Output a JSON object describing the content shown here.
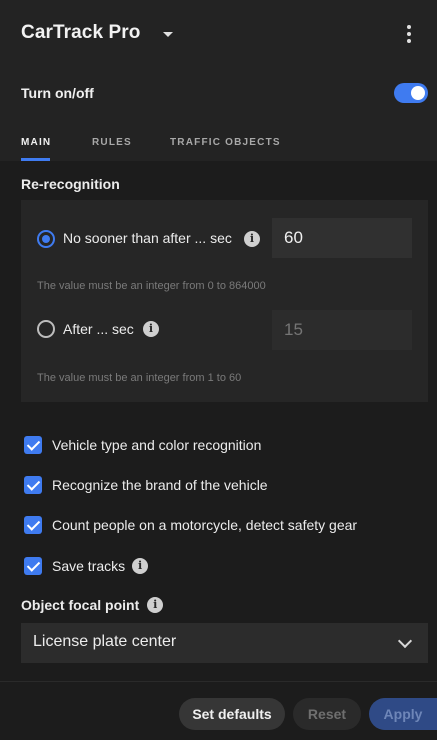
{
  "app": {
    "title": "CarTrack Pro"
  },
  "power": {
    "label": "Turn on/off",
    "enabled": true
  },
  "tabs": [
    {
      "label": "MAIN",
      "active": true
    },
    {
      "label": "RULES",
      "active": false
    },
    {
      "label": "TRAFFIC OBJECTS",
      "active": false
    }
  ],
  "recognition": {
    "section_title": "Re-recognition",
    "option1": {
      "label": "No sooner than after ... sec",
      "value": "60",
      "hint": "The value must be an integer from 0 to 864000",
      "selected": true
    },
    "option2": {
      "label": "After ... sec",
      "placeholder": "15",
      "hint": "The value must be an integer from 1 to 60",
      "selected": false
    }
  },
  "checkboxes": [
    {
      "label": "Vehicle type and color recognition",
      "checked": true
    },
    {
      "label": "Recognize the brand of the vehicle",
      "checked": true
    },
    {
      "label": "Count people on a motorcycle, detect safety gear",
      "checked": true
    },
    {
      "label": "Save tracks",
      "checked": true
    }
  ],
  "focal_point": {
    "label": "Object focal point",
    "value": "License plate center"
  },
  "footer": {
    "set_defaults": "Set defaults",
    "reset": "Reset",
    "apply": "Apply"
  },
  "info_glyph": "i",
  "colors": {
    "accent": "#3f7bf0",
    "background": "#1c1c1c",
    "header": "#232323"
  }
}
